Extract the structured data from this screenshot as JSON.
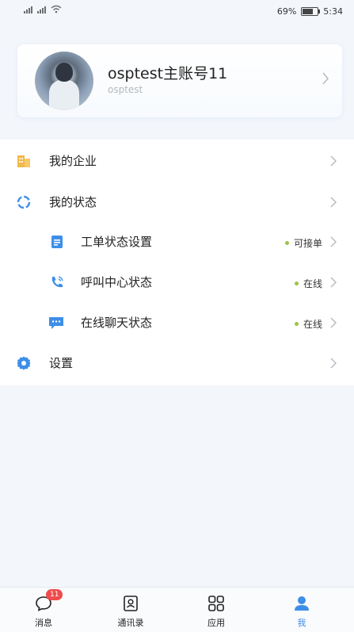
{
  "status_bar": {
    "battery_percent": "69%",
    "battery_level": 0.69,
    "time": "5:34"
  },
  "profile": {
    "name": "osptest主账号11",
    "account": "osptest"
  },
  "menu": {
    "enterprise": "我的企业",
    "my_status": "我的状态",
    "ticket_status": {
      "label": "工单状态设置",
      "value": "可接单"
    },
    "call_center": {
      "label": "呼叫中心状态",
      "value": "在线"
    },
    "online_chat": {
      "label": "在线聊天状态",
      "value": "在线"
    },
    "settings": "设置"
  },
  "tabs": [
    {
      "label": "消息",
      "badge": "11"
    },
    {
      "label": "通讯录"
    },
    {
      "label": "应用"
    },
    {
      "label": "我"
    }
  ],
  "colors": {
    "accent": "#3d8ee8",
    "status_dot": "#9bc24a",
    "badge": "#f04b4b",
    "enterprise_icon": "#f2b84b"
  }
}
